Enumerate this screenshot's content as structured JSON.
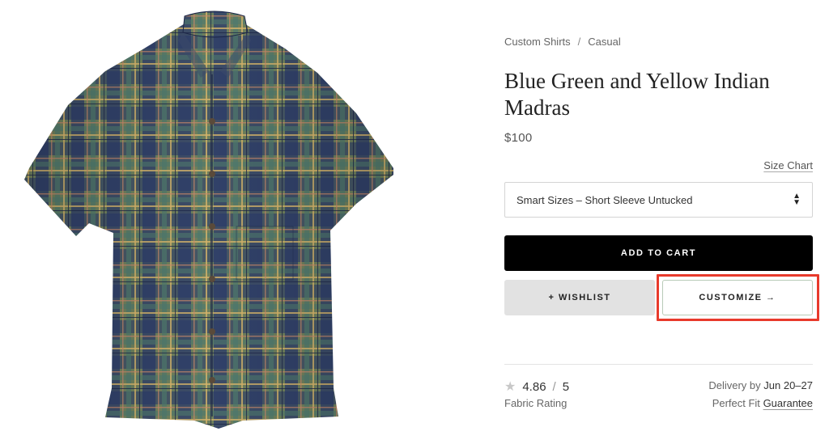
{
  "breadcrumb": {
    "items": [
      "Custom Shirts",
      "Casual"
    ],
    "separator": "/"
  },
  "product": {
    "title": "Blue Green and Yellow Indian Madras",
    "price": "$100",
    "image_icon": "plaid-short-sleeve-shirt"
  },
  "size": {
    "chart_link": "Size Chart",
    "selected": "Smart Sizes – Short Sleeve Untucked",
    "arrow_up": "▲",
    "arrow_down": "▼"
  },
  "actions": {
    "add_to_cart": "ADD TO CART",
    "wishlist": "+ WISHLIST",
    "customize": "CUSTOMIZE →"
  },
  "rating": {
    "star_icon": "★",
    "value": "4.86",
    "separator": "/",
    "max": "5",
    "label": "Fabric Rating"
  },
  "delivery": {
    "prefix": "Delivery by",
    "dates": "Jun 20–27"
  },
  "fit": {
    "prefix": "Perfect Fit",
    "link": "Guarantee"
  },
  "colors": {
    "highlight": "#e83a2b",
    "cart_bg": "#000000",
    "wishlist_bg": "#e2e2e2",
    "shirt_navy": "#2a3b6b",
    "shirt_green": "#5f7a5a",
    "shirt_tan": "#b49a62"
  }
}
